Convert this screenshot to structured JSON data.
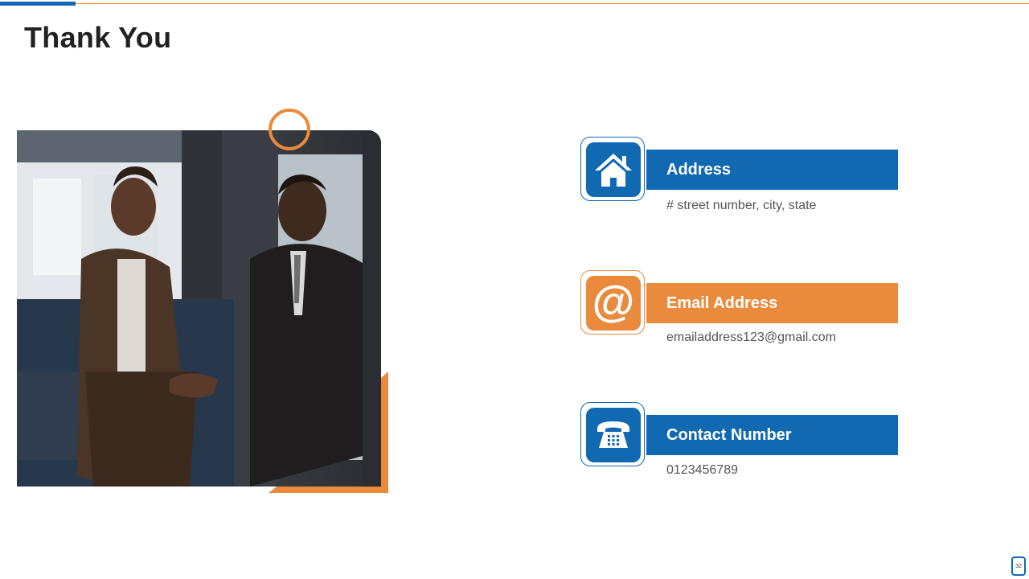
{
  "title": "Thank You",
  "colors": {
    "blue": "#1169B2",
    "orange": "#E98A3C"
  },
  "contacts": [
    {
      "label": "Address",
      "detail": "# street number, city, state",
      "icon": "house-icon",
      "color": "#1169B2"
    },
    {
      "label": "Email Address",
      "detail": "emailaddress123@gmail.com",
      "icon": "at-sign-icon",
      "color": "#E98A3C"
    },
    {
      "label": "Contact Number",
      "detail": "0123456789",
      "icon": "telephone-icon",
      "color": "#1169B2"
    }
  ],
  "page_number": "32"
}
